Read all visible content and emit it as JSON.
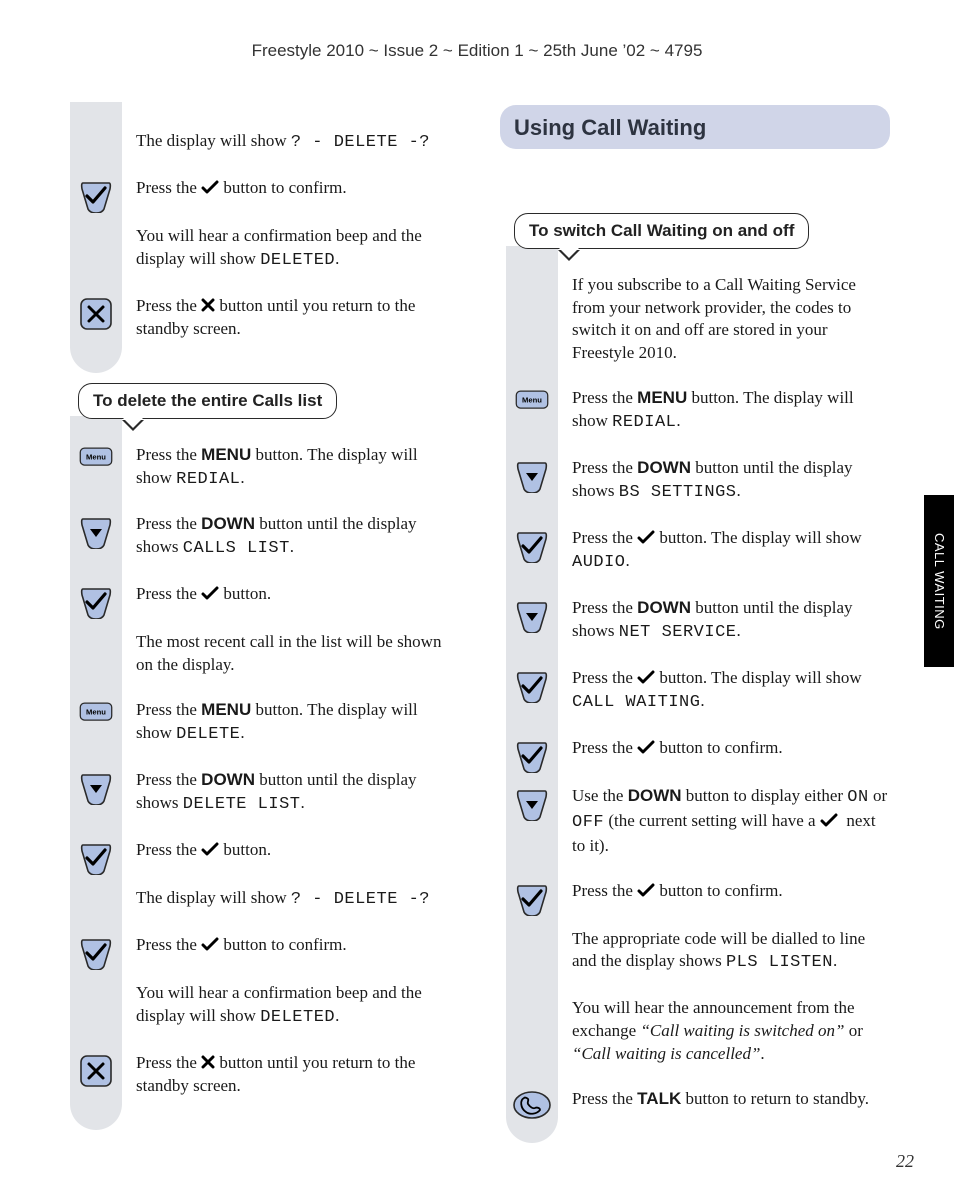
{
  "header_line": "Freestyle 2010 ~ Issue 2 ~ Edition 1 ~ 25th June ’02 ~ 4795",
  "side_tab": "CALL WAITING",
  "page_number": "22",
  "section_heading": "Using Call Waiting",
  "left": {
    "intro": [
      {
        "html": "The display will show <span class='mono'>? - DELETE -?</span>"
      },
      {
        "icon": "check",
        "html": "Press the {check} button to confirm."
      },
      {
        "html": "You will hear a confirmation beep and the display will show <span class='mono'>DELETED</span>."
      },
      {
        "icon": "cross",
        "html": "Press the {cross} button until you return to the standby screen."
      }
    ],
    "subheader": "To delete the entire Calls list",
    "steps": [
      {
        "icon": "menu",
        "html": "Press the <span class='btnword'>MENU</span> button. The display will show <span class='mono'>REDIAL</span>."
      },
      {
        "icon": "down",
        "html": "Press the <span class='btnword'>DOWN</span> button until the display shows <span class='mono'>CALLS LIST</span>."
      },
      {
        "icon": "check",
        "html": "Press the {check} button."
      },
      {
        "html": "The most recent call in the list will be shown on the display."
      },
      {
        "icon": "menu",
        "html": "Press the <span class='btnword'>MENU</span> button.  The display will show <span class='mono'>DELETE</span>."
      },
      {
        "icon": "down",
        "html": "Press the <span class='btnword'>DOWN</span> button until the display shows <span class='mono'>DELETE LIST</span>."
      },
      {
        "icon": "check",
        "html": "Press the {check} button."
      },
      {
        "html": "The display will show <span class='mono'>? - DELETE -?</span>"
      },
      {
        "icon": "check",
        "html": "Press the {check} button to confirm."
      },
      {
        "html": "You will hear a confirmation beep and the display will show <span class='mono'>DELETED</span>."
      },
      {
        "icon": "cross",
        "html": "Press the {cross} button until you return to the standby screen."
      }
    ]
  },
  "right": {
    "subheader": "To switch Call Waiting on and off",
    "steps": [
      {
        "html": "If you subscribe to a Call Waiting Service from your network provider, the codes to switch it on and off are stored in your Freestyle 2010."
      },
      {
        "icon": "menu",
        "html": "Press the <span class='btnword'>MENU</span> button. The display will show <span class='mono'>REDIAL</span>."
      },
      {
        "icon": "down",
        "html": "Press the <span class='btnword'>DOWN</span> button until the display shows <span class='mono'>BS SETTINGS</span>."
      },
      {
        "icon": "check",
        "html": "Press the {check} button. The display will show <span class='mono'>AUDIO</span>."
      },
      {
        "icon": "down",
        "html": "Press the <span class='btnword'>DOWN</span> button until the display shows <span class='mono'>NET SERVICE</span>."
      },
      {
        "icon": "check",
        "html": "Press the {check} button. The display will show <span class='mono'>CALL WAITING</span>."
      },
      {
        "icon": "check",
        "html": "Press the {check} button to confirm."
      },
      {
        "icon": "down",
        "html": "Use the <span class='btnword'>DOWN</span> button to display either <span class='mono'>ON</span> or <span class='mono'>OFF</span> (the current setting will have a {check}&nbsp; next to it)."
      },
      {
        "icon": "check",
        "html": "Press the {check} button to confirm."
      },
      {
        "html": "The appropriate code will be dialled to line and the display shows <span class='mono'>PLS LISTEN</span>."
      },
      {
        "html": "You will hear the announcement from the exchange <em>“Call waiting is switched on”</em> or <em>“Call waiting is cancelled”</em>."
      },
      {
        "icon": "talk",
        "html": "Press the <span class='btnword'>TALK</span> button to return to standby."
      }
    ]
  }
}
